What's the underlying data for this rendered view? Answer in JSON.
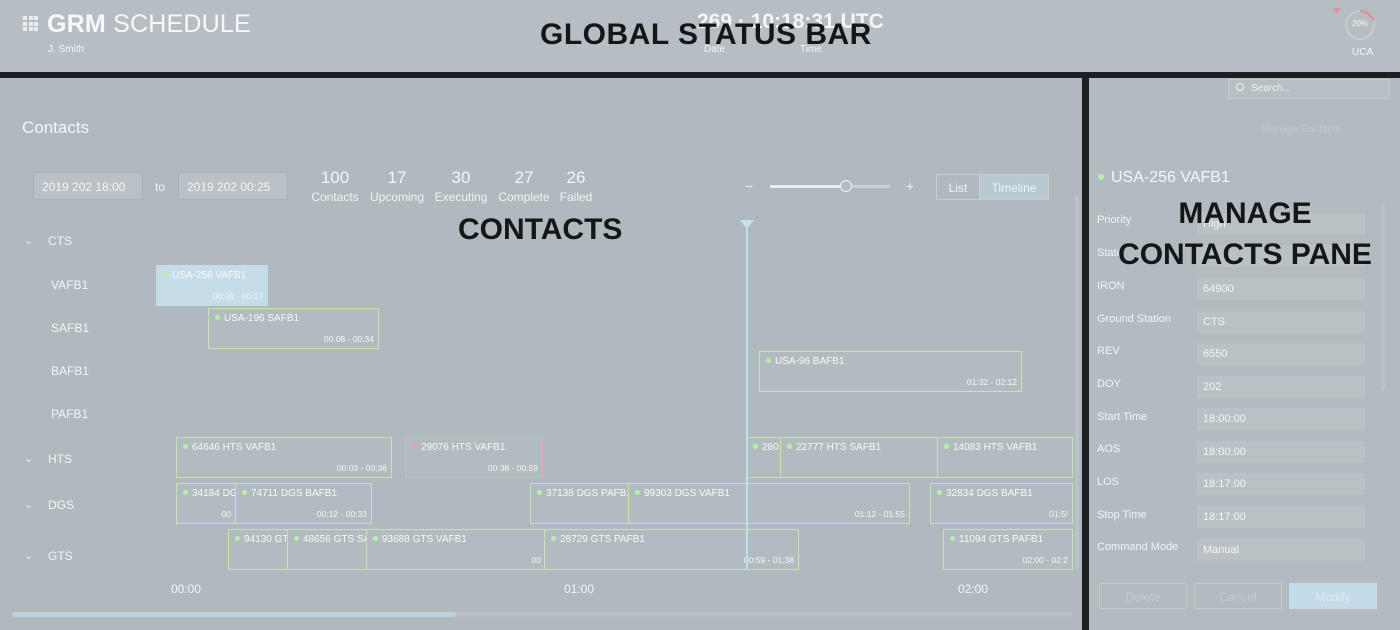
{
  "header": {
    "app_title_bold": "GRM",
    "app_title_light": "SCHEDULE",
    "user": "J. Smith",
    "date_value": "269",
    "time_value": "10:18:31 UTC",
    "date_label": "Date",
    "time_label": "Time",
    "region_label": "GLOBAL STATUS BAR",
    "gauge_percent": "20%",
    "gauge_name": "UCA",
    "gauge_fraction": 0.2
  },
  "contacts": {
    "title": "Contacts",
    "region_label": "CONTACTS",
    "start_date": "2019   202   18:00",
    "to_label": "to",
    "end_date": "2019   202   00:25",
    "stats": [
      {
        "value": "100",
        "label": "Contacts"
      },
      {
        "value": "17",
        "label": "Upcoming"
      },
      {
        "value": "30",
        "label": "Executing"
      },
      {
        "value": "27",
        "label": "Complete"
      },
      {
        "value": "26",
        "label": "Failed"
      }
    ],
    "zoom_minus": "−",
    "zoom_plus": "+",
    "view_list": "List",
    "view_timeline": "Timeline",
    "groups": [
      "CTS",
      "HTS",
      "DGS",
      "GTS"
    ],
    "stations": [
      "VAFB1",
      "SAFB1",
      "BAFB1",
      "PAFB1"
    ],
    "axis": [
      "00:00",
      "01:00",
      "02:00"
    ],
    "bars": [
      {
        "name": "USA-256 VAFB1",
        "time": "00:00 - 00:17",
        "state": "selected"
      },
      {
        "name": "USA-196 SAFB1",
        "time": "00:08 - 00:34",
        "state": "normal"
      },
      {
        "name": "USA-96 BAFB1",
        "time": "01:32 - 02:12",
        "state": "normal"
      },
      {
        "name": "64646 HTS VAFB1",
        "time": "00:03 - 00:36",
        "state": "normal"
      },
      {
        "name": "29076 HTS VAFB1",
        "time": "00:38 - 00:59",
        "state": "failed"
      },
      {
        "name": "280",
        "time": "",
        "state": "normal"
      },
      {
        "name": "22777 HTS SAFB1",
        "time": "",
        "state": "normal"
      },
      {
        "name": "14083 HTS VAFB1",
        "time": "",
        "state": "normal"
      },
      {
        "name": "34184 DG",
        "time": "00",
        "state": "normal"
      },
      {
        "name": "74711 DGS BAFB1",
        "time": "00:12 - 00:33",
        "state": "normal"
      },
      {
        "name": "37138 DGS PAFB1",
        "time": "",
        "state": "normal"
      },
      {
        "name": "99303 DGS VAFB1",
        "time": "01:12 - 01:55",
        "state": "normal"
      },
      {
        "name": "32834 DGS BAFB1",
        "time": "01:5!",
        "state": "normal"
      },
      {
        "name": "94130 GT",
        "time": "",
        "state": "normal"
      },
      {
        "name": "48656 GTS SA",
        "time": "",
        "state": "normal"
      },
      {
        "name": "93688 GTS VAFB1",
        "time": "00",
        "state": "normal"
      },
      {
        "name": "28729 GTS PAFB1",
        "time": "00:59 - 01:38",
        "state": "normal"
      },
      {
        "name": "11094 GTS PAFB1",
        "time": "02:00 - 02:2",
        "state": "normal"
      }
    ]
  },
  "manage": {
    "region_label": "MANAGE CONTACTS PANE",
    "search_placeholder": "Search...",
    "manage_link": "Manage Contacts",
    "contact_title": "USA-256 VAFB1",
    "fields": [
      {
        "label": "Priority",
        "value": "High"
      },
      {
        "label": "State",
        "value": ""
      },
      {
        "label": "IRON",
        "value": "64900"
      },
      {
        "label": "Ground Station",
        "value": "CTS"
      },
      {
        "label": "REV",
        "value": "6550"
      },
      {
        "label": "DOY",
        "value": "202"
      },
      {
        "label": "Start Time",
        "value": "18:00:00"
      },
      {
        "label": "AOS",
        "value": "18:00:00"
      },
      {
        "label": "LOS",
        "value": "18:17:00"
      },
      {
        "label": "Stop Time",
        "value": "18:17:00"
      },
      {
        "label": "Command Mode",
        "value": "Manual"
      }
    ],
    "buttons": {
      "delete": "Delete",
      "cancel": "Cancel",
      "modify": "Modify"
    }
  }
}
